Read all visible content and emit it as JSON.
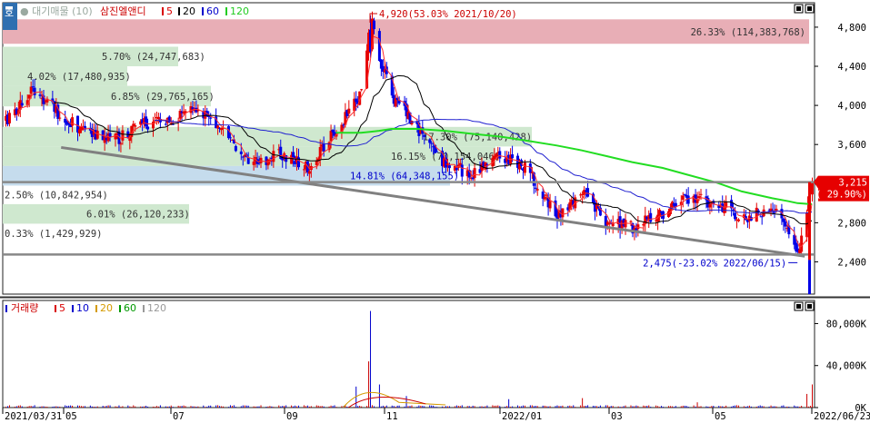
{
  "legend_price": {
    "prefix": "● 대기매물 (10)",
    "name": "삼진엘앤디",
    "ma": [
      {
        "label": "5",
        "color": "#d90000"
      },
      {
        "label": "20",
        "color": "#000000"
      },
      {
        "label": "60",
        "color": "#0000cc"
      },
      {
        "label": "120",
        "color": "#22cc22"
      }
    ]
  },
  "legend_volume": {
    "name": "거래량",
    "ma": [
      {
        "label": "5",
        "color": "#d90000"
      },
      {
        "label": "10",
        "color": "#0000cc"
      },
      {
        "label": "20",
        "color": "#d49a00"
      },
      {
        "label": "60",
        "color": "#009900"
      },
      {
        "label": "120",
        "color": "#999999"
      }
    ]
  },
  "corner_label": "호",
  "colors": {
    "up": "#e60000",
    "down": "#0000e6",
    "band_red": "#e8aeb6",
    "band_green": "#cfe8cf",
    "band_blue": "#c5dced",
    "ma120": "#22dd22",
    "trend": "#808080"
  },
  "chart_data": [
    {
      "type": "line",
      "title": "삼진엘앤디",
      "y_ticks": [
        "4,800",
        "4,400",
        "4,000",
        "3,600",
        "3,200",
        "2,800",
        "2,400"
      ],
      "y_values": [
        4800,
        4400,
        4000,
        3600,
        3200,
        2800,
        2400
      ],
      "ylim": [
        2070,
        5050
      ],
      "x_ticks": [
        "2021/03/31",
        "05",
        "07",
        "09",
        "11",
        "2022/01",
        "03",
        "05",
        "2022/06/23"
      ],
      "x": [
        "2021-03-31",
        "2021-04-15",
        "2021-05-01",
        "2021-05-15",
        "2021-06-01",
        "2021-06-15",
        "2021-07-01",
        "2021-07-15",
        "2021-08-01",
        "2021-08-15",
        "2021-09-01",
        "2021-09-15",
        "2021-10-01",
        "2021-10-15",
        "2021-10-20",
        "2021-10-25",
        "2021-11-01",
        "2021-11-15",
        "2021-12-01",
        "2021-12-15",
        "2022-01-01",
        "2022-01-15",
        "2022-02-01",
        "2022-02-15",
        "2022-03-01",
        "2022-03-15",
        "2022-04-01",
        "2022-04-15",
        "2022-05-01",
        "2022-05-15",
        "2022-06-01",
        "2022-06-10",
        "2022-06-15",
        "2022-06-23"
      ],
      "series": [
        {
          "name": "close",
          "values": [
            3850,
            4150,
            3900,
            3700,
            3650,
            3800,
            3850,
            3950,
            3700,
            3400,
            3500,
            3350,
            3750,
            4100,
            4920,
            4500,
            4100,
            3750,
            3400,
            3300,
            3500,
            3350,
            2850,
            3100,
            2800,
            2750,
            2900,
            3050,
            3000,
            2850,
            2950,
            2700,
            2475,
            3215
          ]
        },
        {
          "name": "120",
          "values": [
            null,
            null,
            null,
            null,
            null,
            null,
            null,
            null,
            null,
            null,
            null,
            null,
            3720,
            3720,
            3730,
            3740,
            3760,
            3760,
            3740,
            3710,
            3680,
            3640,
            3590,
            3540,
            3480,
            3420,
            3360,
            3290,
            3210,
            3120,
            3050,
            3020,
            3000,
            2990
          ]
        }
      ],
      "price_bands": [
        {
          "label": "26.33% (114,383,768)",
          "from": 4630,
          "to": 4880,
          "color": "red"
        },
        {
          "label": "5.70% (24,747,683)",
          "from": 4400,
          "to": 4600,
          "color": "green"
        },
        {
          "label": "4.02% (17,480,935)",
          "from": 4200,
          "to": 4400,
          "color": "green"
        },
        {
          "label": "6.85% (29,765,165)",
          "from": 3990,
          "to": 4200,
          "color": "green"
        },
        {
          "label": "17.30% (75,140,428)",
          "from": 3580,
          "to": 3780,
          "color": "green"
        },
        {
          "label": "16.15% (70,154,046)",
          "from": 3380,
          "to": 3580,
          "color": "green"
        },
        {
          "label": "14.81% (64,348,155)",
          "from": 3180,
          "to": 3380,
          "color": "blue"
        },
        {
          "label": "2.50% (10,842,954)",
          "from": 2990,
          "to": 3180,
          "color": "none"
        },
        {
          "label": "6.01% (26,120,233)",
          "from": 2790,
          "to": 2990,
          "color": "green"
        },
        {
          "label": "0.33% (1,429,929)",
          "from": 2590,
          "to": 2790,
          "color": "none"
        }
      ],
      "annotations": {
        "high": "4,920(53.03% 2021/10/20)",
        "low": "2,475(-23.02% 2022/06/15)",
        "current_price": "3,215",
        "current_change": "( 29.90%)"
      },
      "horizontal_lines": [
        3215,
        2475
      ],
      "trend_line": {
        "from_date": "2021-05-01",
        "from_value": 3570,
        "to_date": "2022-06-15",
        "to_value": 2420
      }
    },
    {
      "type": "bar",
      "title": "거래량",
      "y_ticks": [
        "80,000K",
        "40,000K",
        "0K"
      ],
      "y_values": [
        80000,
        40000,
        0
      ],
      "ylim": [
        0,
        102000
      ],
      "spikes": [
        {
          "date": "2021-10-20",
          "value": 92000
        },
        {
          "date": "2021-10-19",
          "value": 44000
        },
        {
          "date": "2021-10-25",
          "value": 22000
        },
        {
          "date": "2021-10-12",
          "value": 20000
        },
        {
          "date": "2021-11-09",
          "value": 11000
        },
        {
          "date": "2022-01-05",
          "value": 8000
        },
        {
          "date": "2022-02-15",
          "value": 9000
        },
        {
          "date": "2022-04-20",
          "value": 5000
        },
        {
          "date": "2022-06-23",
          "value": 22000
        },
        {
          "date": "2022-06-20",
          "value": 13000
        }
      ]
    }
  ]
}
